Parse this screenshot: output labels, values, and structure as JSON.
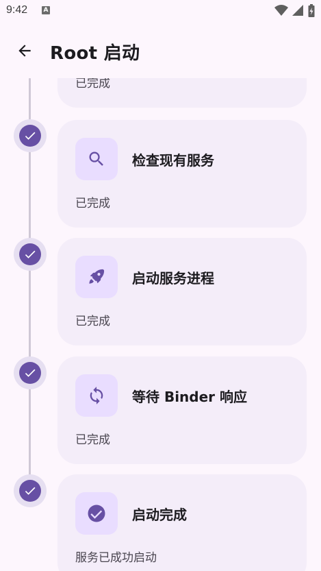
{
  "status_bar": {
    "time": "9:42",
    "notification_badge": "A",
    "icons": [
      "wifi-icon",
      "signal-icon",
      "battery-icon"
    ]
  },
  "app_bar": {
    "back_icon": "arrow-back-icon",
    "title": "Root 启动"
  },
  "colors": {
    "background": "#fdf6fd",
    "card": "#f4edf9",
    "accent": "#6750a4",
    "icon_box": "#e9ddff",
    "timeline": "#cfc8d6"
  },
  "steps": [
    {
      "title": "",
      "status": "已完成",
      "icon": "",
      "completed": true
    },
    {
      "title": "检查现有服务",
      "status": "已完成",
      "icon": "search-icon",
      "completed": true
    },
    {
      "title": "启动服务进程",
      "status": "已完成",
      "icon": "rocket-icon",
      "completed": true
    },
    {
      "title": "等待 Binder 响应",
      "status": "已完成",
      "icon": "sync-icon",
      "completed": true
    },
    {
      "title": "启动完成",
      "status": "服务已成功启动",
      "icon": "check-circle-icon",
      "completed": true
    }
  ]
}
